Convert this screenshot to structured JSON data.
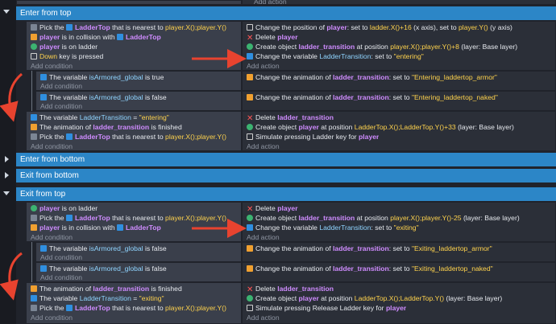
{
  "top_partial": {
    "add_action": "Add action"
  },
  "groups": {
    "enter_from_top": "Enter from top",
    "enter_from_bottom": "Enter from bottom",
    "exit_from_bottom": "Exit from bottom",
    "exit_from_top": "Exit from top"
  },
  "enter_top": {
    "c1": [
      "Pick the ",
      "LadderTop",
      " that is nearest to ",
      "player.X();player.Y()"
    ],
    "c2": [
      "player",
      " is in collision with ",
      "LadderTop"
    ],
    "c3": [
      "player",
      " is on ladder"
    ],
    "c4": [
      "Down",
      " key is pressed"
    ],
    "add_condition": "Add condition",
    "a1": [
      "Change the position of ",
      "player",
      ": set to ",
      "ladder.X()+16",
      " (x axis), set to ",
      "player.Y()",
      " (y axis)"
    ],
    "a2": [
      "Delete ",
      "player"
    ],
    "a3": [
      "Create object ",
      "ladder_transition",
      " at position ",
      "player.X();player.Y()+8",
      " (layer: Base layer)"
    ],
    "a4": [
      "Change the variable ",
      "LadderTransition",
      ": set to ",
      "\"entering\""
    ],
    "add_action": "Add action",
    "sub1_cond": [
      "The variable ",
      "isArmored_global",
      " is ",
      "true"
    ],
    "sub1_act": [
      "Change the animation of ",
      "ladder_transition",
      ": set to ",
      "\"Entering_laddertop_armor\""
    ],
    "sub2_cond": [
      "The variable ",
      "isArmored_global",
      " is ",
      "false"
    ],
    "sub2_act": [
      "Change the animation of ",
      "ladder_transition",
      ": set to ",
      "\"Entering_laddertop_naked\""
    ],
    "e3_c1": [
      "The variable ",
      "LadderTransition",
      " = ",
      "\"entering\""
    ],
    "e3_c2": [
      "The animation of ",
      "ladder_transition",
      " is finished"
    ],
    "e3_c3": [
      "Pick the ",
      "LadderTop",
      " that is nearest to ",
      "player.X();player.Y()"
    ],
    "e3_a1": [
      "Delete ",
      "ladder_transition"
    ],
    "e3_a2": [
      "Create object ",
      "player",
      " at position ",
      "LadderTop.X();LadderTop.Y()+33",
      " (layer: Base layer)"
    ],
    "e3_a3": [
      "Simulate pressing Ladder key for ",
      "player"
    ]
  },
  "exit_top": {
    "c1": [
      "player",
      " is on ladder"
    ],
    "c2": [
      "Pick the ",
      "LadderTop",
      " that is nearest to ",
      "player.X();player.Y()"
    ],
    "c3": [
      "player",
      " is in collision with ",
      "LadderTop"
    ],
    "add_condition": "Add condition",
    "a1": [
      "Delete ",
      "player"
    ],
    "a2": [
      "Create object ",
      "ladder_transition",
      " at position ",
      "player.X();player.Y()-25",
      " (layer: Base layer)"
    ],
    "a3": [
      "Change the variable ",
      "LadderTransition",
      ": set to ",
      "\"exiting\""
    ],
    "add_action": "Add action",
    "sub1_cond": [
      "The variable ",
      "isArmored_global",
      " is ",
      "false"
    ],
    "sub1_act": [
      "Change the animation of ",
      "ladder_transition",
      ": set to ",
      "\"Exiting_laddertop_armor\""
    ],
    "sub2_cond": [
      "The variable ",
      "isArmored_global",
      " is ",
      "false"
    ],
    "sub2_act": [
      "Change the animation of ",
      "ladder_transition",
      ": set to ",
      "\"Exiting_laddertop_naked\""
    ],
    "e3_c1": [
      "The animation of ",
      "ladder_transition",
      " is finished"
    ],
    "e3_c2": [
      "The variable ",
      "LadderTransition",
      " = ",
      "\"exiting\""
    ],
    "e3_c3": [
      "Pick the ",
      "LadderTop",
      " that is nearest to ",
      "player.X();player.Y()"
    ],
    "e3_a1": [
      "Delete ",
      "ladder_transition"
    ],
    "e3_a2": [
      "Create object ",
      "player",
      " at position ",
      "LadderTop.X();LadderTop.Y()",
      " (layer: Base layer)"
    ],
    "e3_a3": [
      "Simulate pressing Release Ladder key for ",
      "player"
    ]
  },
  "colors": {
    "group_header": "#2c86c7",
    "condition_bg": "#3a3f4b",
    "action_bg": "#2b2f38",
    "object": "#cf8cff",
    "expression": "#ffd34d",
    "variable": "#8fd4ff",
    "arrow": "#e8432f"
  }
}
